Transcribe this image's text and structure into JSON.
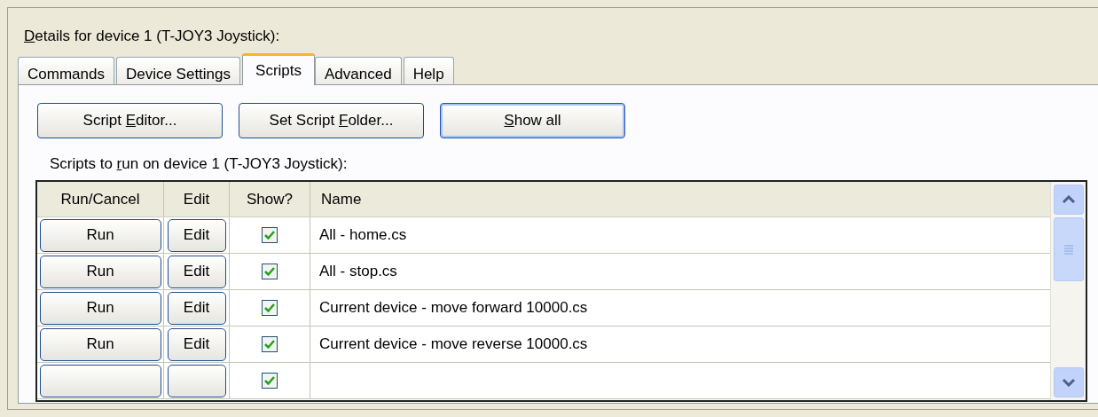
{
  "title": {
    "parts": {
      "key": "D",
      "after": "etails for device 1 (T-JOY3 Joystick):"
    }
  },
  "tabs": [
    {
      "label": "Commands",
      "selected": false
    },
    {
      "label": "Device Settings",
      "selected": false
    },
    {
      "label": "Scripts",
      "selected": true
    },
    {
      "label": "Advanced",
      "selected": false
    },
    {
      "label": "Help",
      "selected": false
    }
  ],
  "buttons": [
    {
      "parts": {
        "before": "Script ",
        "key": "E",
        "after": "ditor..."
      },
      "default": false
    },
    {
      "parts": {
        "before": "Set Script ",
        "key": "F",
        "after": "older..."
      },
      "default": false
    },
    {
      "parts": {
        "key": "S",
        "after": "how all"
      },
      "default": true
    }
  ],
  "scripts_label": {
    "parts": {
      "before": "Scripts to ",
      "key": "r",
      "after": "un on device 1 (T-JOY3 Joystick):"
    }
  },
  "table": {
    "columns": [
      "Run/Cancel",
      "Edit",
      "Show?",
      "Name"
    ],
    "rows": [
      {
        "run": "Run",
        "edit": "Edit",
        "show": true,
        "name": "All - home.cs"
      },
      {
        "run": "Run",
        "edit": "Edit",
        "show": true,
        "name": "All - stop.cs"
      },
      {
        "run": "Run",
        "edit": "Edit",
        "show": true,
        "name": "Current device - move forward 10000.cs"
      },
      {
        "run": "Run",
        "edit": "Edit",
        "show": true,
        "name": "Current device - move reverse 10000.cs"
      },
      {
        "show": true
      }
    ]
  }
}
